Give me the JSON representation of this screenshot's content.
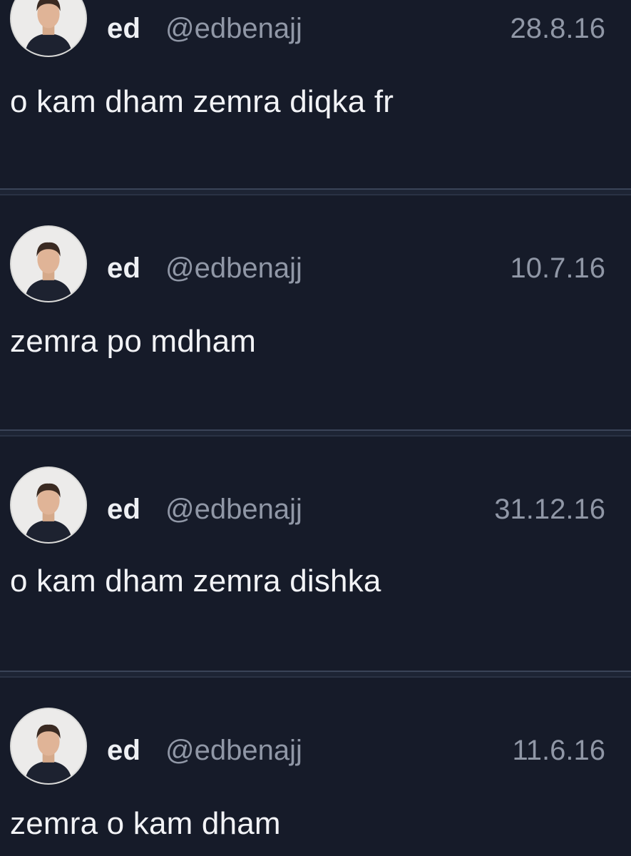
{
  "tweets": [
    {
      "name": "ed",
      "handle": "@edbenajj",
      "date": "28.8.16",
      "text": "o kam dham zemra diqka fr"
    },
    {
      "name": "ed",
      "handle": "@edbenajj",
      "date": "10.7.16",
      "text": "zemra po mdham"
    },
    {
      "name": "ed",
      "handle": "@edbenajj",
      "date": "31.12.16",
      "text": "o kam dham zemra dishka"
    },
    {
      "name": "ed",
      "handle": "@edbenajj",
      "date": "11.6.16",
      "text": "zemra o kam dham"
    }
  ],
  "icons": {
    "avatar": "profile-photo"
  },
  "colors": {
    "background": "#161b29",
    "divider": "#3a4458",
    "name": "#eef0f4",
    "meta": "#9097a6"
  }
}
